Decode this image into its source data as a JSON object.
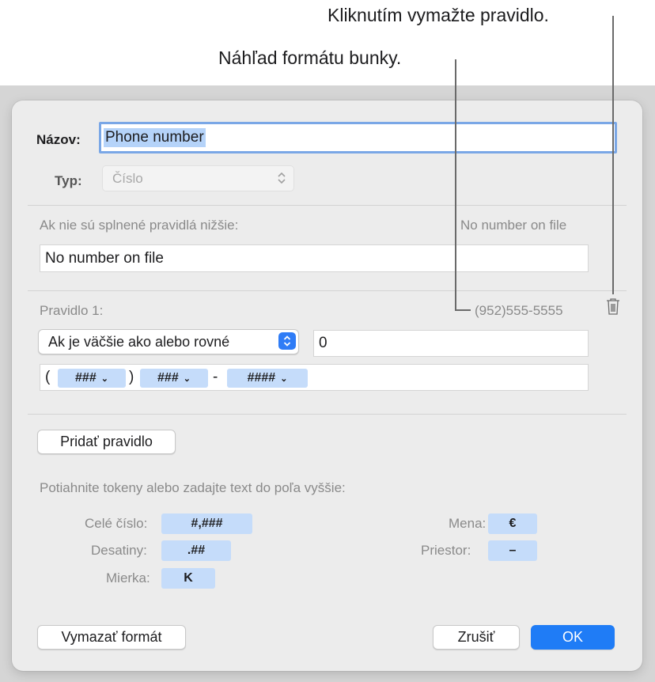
{
  "callouts": {
    "delete_rule": "Kliknutím vymažte pravidlo.",
    "preview": "Náhľad formátu bunky."
  },
  "dialog": {
    "name_label": "Názov:",
    "name_value": "Phone number",
    "type_label": "Typ:",
    "type_value": "Číslo",
    "fallback_label": "Ak nie sú splnené pravidlá nižšie:",
    "fallback_preview": "No number on file",
    "fallback_value": "No number on file",
    "rule": {
      "title": "Pravidlo 1:",
      "preview": "(952)555-5555",
      "condition": "Ak je väčšie ako alebo rovné",
      "condition_value": "0",
      "format_parts": [
        "(",
        "###",
        ")",
        "###",
        "-",
        "####"
      ]
    },
    "add_rule_button": "Pridať pravidlo",
    "hint": "Potiahnite tokeny alebo zadajte text do poľa vyššie:",
    "tokens": {
      "integer_label": "Celé číslo:",
      "integer": "#,###",
      "decimals_label": "Desatiny:",
      "decimals": ".##",
      "scale_label": "Mierka:",
      "scale": "K",
      "currency_label": "Mena:",
      "currency": "€",
      "space_label": "Priestor:",
      "space": "–"
    },
    "clear_button": "Vymazať formát",
    "cancel_button": "Zrušiť",
    "ok_button": "OK"
  },
  "icons": {
    "delete": "trash-icon",
    "stepper": "up-down-chevron-icon",
    "token_menu": "chevron-down-icon"
  },
  "colors": {
    "accent": "#1f7cf6",
    "token": "#c5dcfa",
    "selection": "#b5d3f9"
  }
}
